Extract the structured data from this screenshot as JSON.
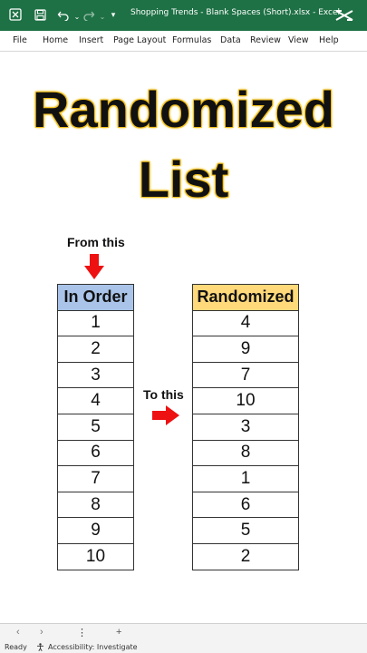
{
  "titlebar": {
    "document_title": "Shopping Trends - Blank Spaces (Short).xlsx  -  Excel",
    "icons": [
      "excel-icon",
      "save-icon",
      "undo-icon",
      "redo-icon",
      "customize-icon",
      "capcut-icon"
    ],
    "bg_color": "#1e7145"
  },
  "ribbon": {
    "tabs": [
      "File",
      "Home",
      "Insert",
      "Page Layout",
      "Formulas",
      "Data",
      "Review",
      "View",
      "Help"
    ]
  },
  "sheet": {
    "title_line1": "Randomized",
    "title_line2": "List",
    "from_label": "From this",
    "to_label": "To this",
    "arrow_color": "#ee1111",
    "title_glow_color": "#f2c01e",
    "in_order": {
      "header": "In Order",
      "header_color": "#a9c4e8",
      "values": [
        "1",
        "2",
        "3",
        "4",
        "5",
        "6",
        "7",
        "8",
        "9",
        "10"
      ]
    },
    "randomized": {
      "header": "Randomized",
      "header_color": "#ffd97a",
      "values": [
        "4",
        "9",
        "7",
        "10",
        "3",
        "8",
        "1",
        "6",
        "5",
        "2"
      ]
    }
  },
  "sheetbar": {
    "prev": "‹",
    "next": "›",
    "more": "⋮",
    "add": "+"
  },
  "status": {
    "ready": "Ready",
    "accessibility": "Accessibility: Investigate"
  }
}
